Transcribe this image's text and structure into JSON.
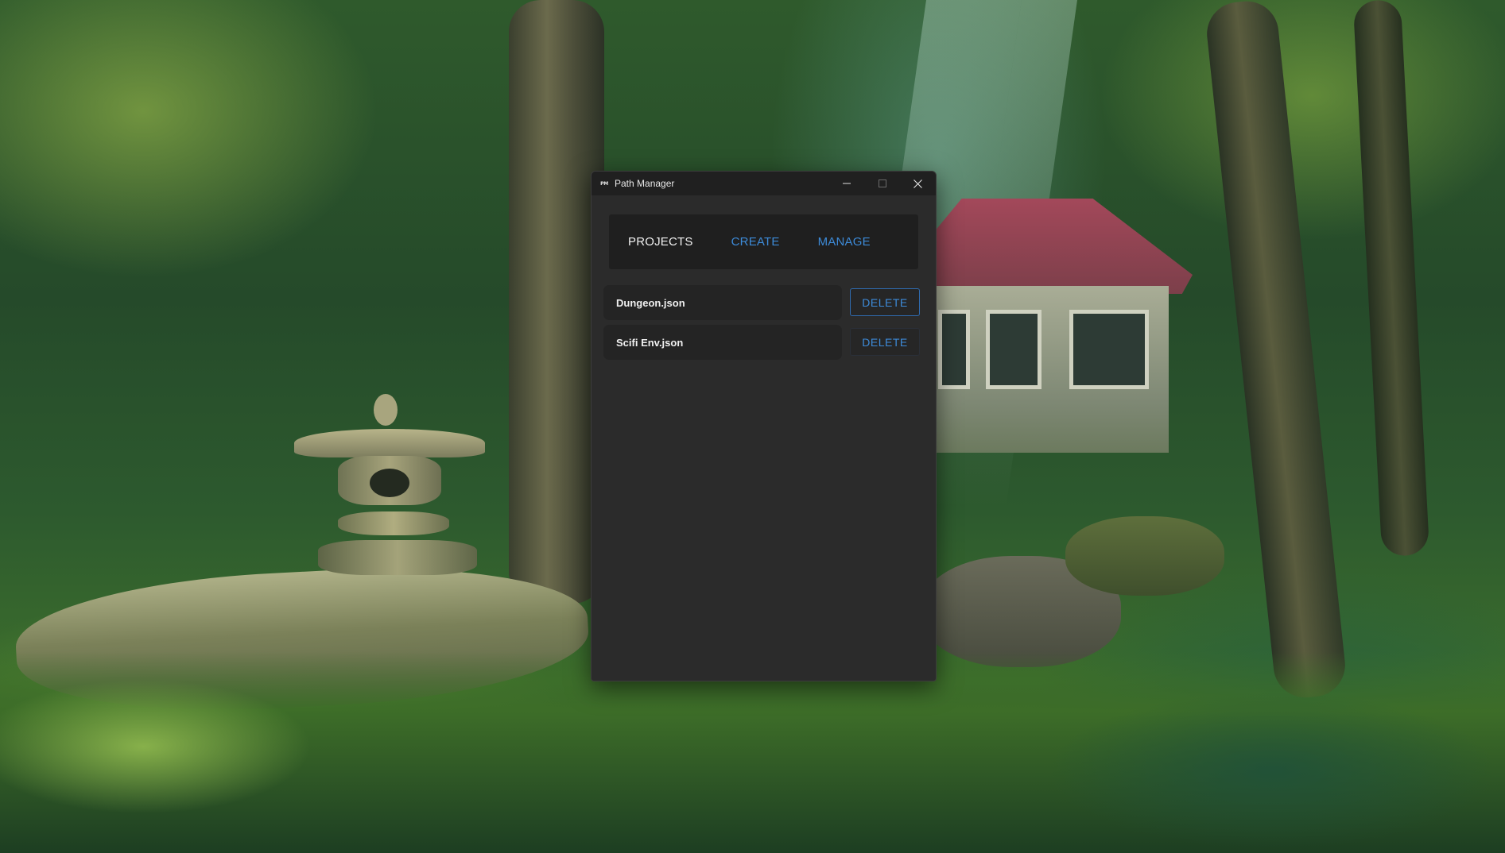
{
  "window": {
    "title": "Path Manager",
    "app_icon_text": "PM",
    "controls": [
      "minimize",
      "maximize",
      "close"
    ]
  },
  "nav": {
    "items": [
      {
        "label": "PROJECTS",
        "active": true
      },
      {
        "label": "CREATE",
        "active": false
      },
      {
        "label": "MANAGE",
        "active": false
      }
    ]
  },
  "projects": [
    {
      "name": "Dungeon.json",
      "delete_label": "DELETE"
    },
    {
      "name": "Scifi Env.json",
      "delete_label": "DELETE"
    }
  ],
  "colors": {
    "accent": "#3d8bd9",
    "window_bg": "#2b2b2b",
    "titlebar_bg": "#202020",
    "nav_bg": "#1f1f1f"
  },
  "icons": {
    "minimize": "minimize-icon",
    "maximize": "maximize-icon",
    "close": "close-icon"
  }
}
